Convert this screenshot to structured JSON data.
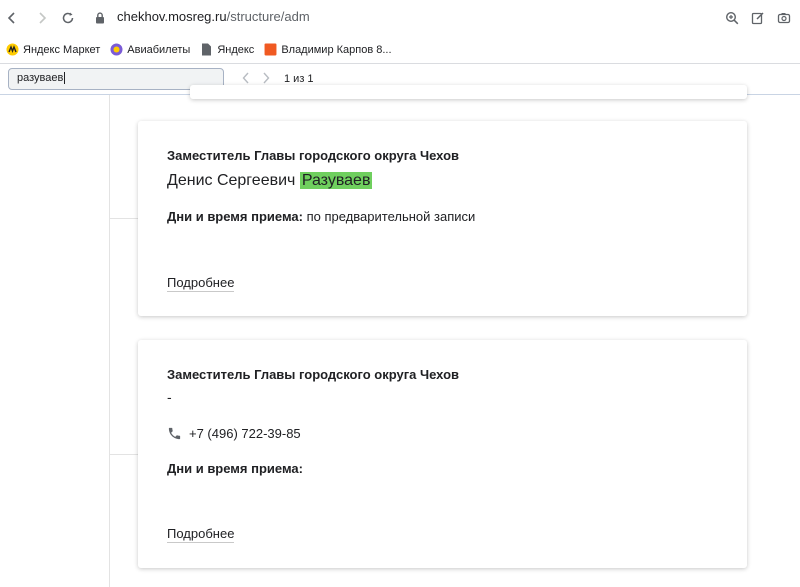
{
  "browser": {
    "url_host": "chekhov.mosreg.ru",
    "url_path": "/structure/adm"
  },
  "bookmarks": [
    {
      "label": "Яндекс Маркет",
      "color": "#ffcc00"
    },
    {
      "label": "Авиабилеты",
      "color": "#7b5cd6"
    },
    {
      "label": "Яндекс",
      "color": "#5f6368"
    },
    {
      "label": "Владимир Карпов 8...",
      "color": "#f05a22"
    }
  ],
  "find": {
    "query": "разуваев",
    "count": "1 из 1"
  },
  "cards": [
    {
      "title": "Заместитель Главы городского округа Чехов",
      "name_plain": "Денис Сергеевич ",
      "name_highlight": "Разуваев",
      "reception_label": "Дни и время приема:",
      "reception_value": " по предварительной записи",
      "more": "Подробнее"
    },
    {
      "title": "Заместитель Главы городского округа Чехов",
      "name_plain": "-",
      "phone": "+7 (496) 722-39-85",
      "reception_label": "Дни и время приема:",
      "more": "Подробнее"
    }
  ],
  "colors": {
    "highlight": "#6fcf5e"
  }
}
